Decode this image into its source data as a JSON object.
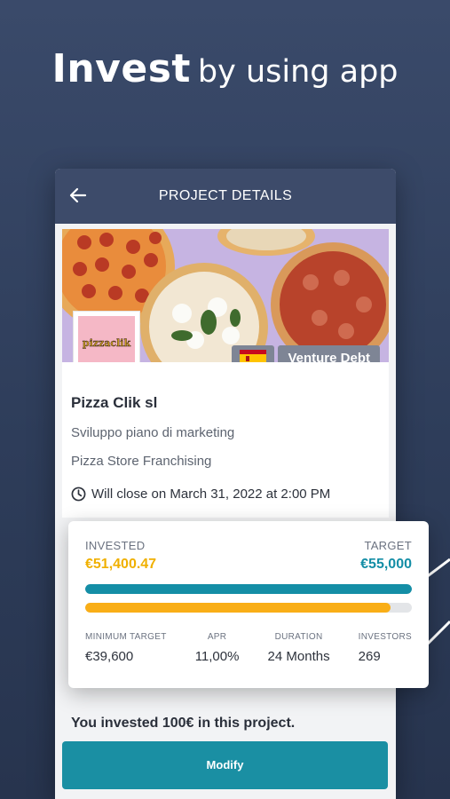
{
  "headline": {
    "bold": "Invest",
    "rest": "by using app"
  },
  "appbar": {
    "title": "PROJECT DETAILS",
    "back_icon": "arrow-left-icon"
  },
  "project": {
    "logo_text": "pizzaclik",
    "country_flag": "spain-flag-icon",
    "type_badge": "Venture Debt",
    "company": "Pizza Clik sl",
    "description": "Sviluppo piano di marketing",
    "category": "Pizza Store Franchising",
    "close_text": "Will close on March 31, 2022 at 2:00 PM"
  },
  "funding": {
    "invested_label": "INVESTED",
    "invested_value": "€51,400.47",
    "target_label": "TARGET",
    "target_value": "€55,000",
    "progress_fraction": 0.935,
    "metrics": [
      {
        "label": "MINIMUM TARGET",
        "value": "€39,600"
      },
      {
        "label": "APR",
        "value": "11,00%"
      },
      {
        "label": "DURATION",
        "value": "24 Months"
      },
      {
        "label": "INVESTORS",
        "value": "269"
      }
    ]
  },
  "user_note": "You invested 100€ in this project.",
  "modify_button": "Modify",
  "colors": {
    "teal": "#148ea6",
    "gold": "#f9ae17",
    "navy": "#3d4b6a"
  }
}
